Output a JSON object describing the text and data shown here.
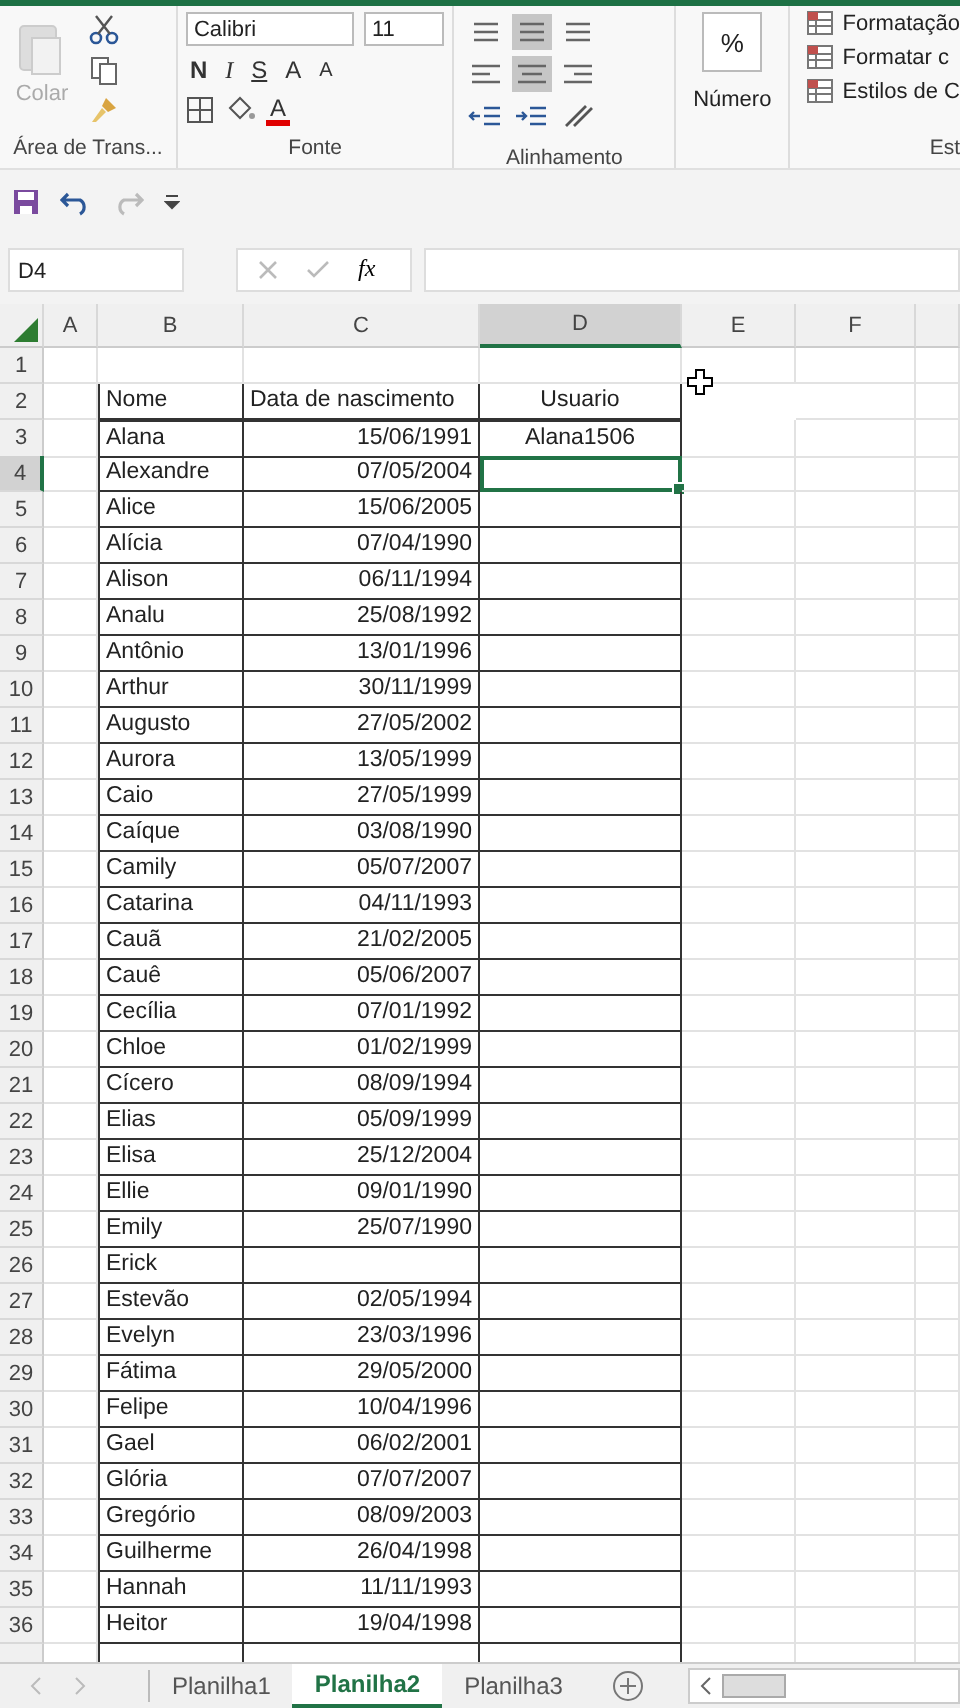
{
  "ribbon": {
    "clipboard": {
      "paste_label": "Colar",
      "group_label": "Área de Trans..."
    },
    "font": {
      "name": "Calibri",
      "size": "11",
      "bold": "N",
      "italic": "I",
      "underline": "S",
      "grow": "A",
      "shrink": "A",
      "font_color": "A",
      "group_label": "Fonte"
    },
    "alignment": {
      "group_label": "Alinhamento"
    },
    "number": {
      "symbol": "%",
      "label": "Número"
    },
    "styles": {
      "items": [
        "Formatação",
        "Formatar c",
        "Estilos de C"
      ],
      "group_label": "Est"
    }
  },
  "name_box": "D4",
  "fx": "fx",
  "columns": [
    {
      "label": "A",
      "selected": false
    },
    {
      "label": "B",
      "selected": false
    },
    {
      "label": "C",
      "selected": false
    },
    {
      "label": "D",
      "selected": true
    },
    {
      "label": "E",
      "selected": false
    },
    {
      "label": "F",
      "selected": false
    }
  ],
  "header": {
    "number": "2",
    "name": "Nome",
    "date": "Data de nascimento",
    "user": "Usuario"
  },
  "rows": [
    {
      "number": "3",
      "name": "Alana",
      "date": "15/06/1991",
      "user": "Alana1506",
      "selected": false
    },
    {
      "number": "4",
      "name": "Alexandre",
      "date": "07/05/2004",
      "selected": true
    },
    {
      "number": "5",
      "name": "Alice",
      "date": "15/06/2005",
      "selected": false
    },
    {
      "number": "6",
      "name": "Alícia",
      "date": "07/04/1990",
      "selected": false
    },
    {
      "number": "7",
      "name": "Alison",
      "date": "06/11/1994",
      "selected": false
    },
    {
      "number": "8",
      "name": "Analu",
      "date": "25/08/1992",
      "selected": false
    },
    {
      "number": "9",
      "name": "Antônio",
      "date": "13/01/1996",
      "selected": false
    },
    {
      "number": "10",
      "name": "Arthur",
      "date": "30/11/1999",
      "selected": false
    },
    {
      "number": "11",
      "name": "Augusto",
      "date": "27/05/2002",
      "selected": false
    },
    {
      "number": "12",
      "name": "Aurora",
      "date": "13/05/1999",
      "selected": false
    },
    {
      "number": "13",
      "name": "Caio",
      "date": "27/05/1999",
      "selected": false
    },
    {
      "number": "14",
      "name": "Caíque",
      "date": "03/08/1990",
      "selected": false
    },
    {
      "number": "15",
      "name": "Camily",
      "date": "05/07/2007",
      "selected": false
    },
    {
      "number": "16",
      "name": "Catarina",
      "date": "04/11/1993",
      "selected": false
    },
    {
      "number": "17",
      "name": "Cauã",
      "date": "21/02/2005",
      "selected": false
    },
    {
      "number": "18",
      "name": "Cauê",
      "date": "05/06/2007",
      "selected": false
    },
    {
      "number": "19",
      "name": "Cecília",
      "date": "07/01/1992",
      "selected": false
    },
    {
      "number": "20",
      "name": "Chloe",
      "date": "01/02/1999",
      "selected": false
    },
    {
      "number": "21",
      "name": "Cícero",
      "date": "08/09/1994",
      "selected": false
    },
    {
      "number": "22",
      "name": "Elias",
      "date": "05/09/1999",
      "selected": false
    },
    {
      "number": "23",
      "name": "Elisa",
      "date": "25/12/2004",
      "selected": false
    },
    {
      "number": "24",
      "name": "Ellie",
      "date": "09/01/1990",
      "selected": false
    },
    {
      "number": "25",
      "name": "Emily",
      "date": "25/07/1990",
      "selected": false
    },
    {
      "number": "26",
      "name": "Erick",
      "selected": false
    },
    {
      "number": "27",
      "name": "Estevão",
      "date": "02/05/1994",
      "selected": false
    },
    {
      "number": "28",
      "name": "Evelyn",
      "date": "23/03/1996",
      "selected": false
    },
    {
      "number": "29",
      "name": "Fátima",
      "date": "29/05/2000",
      "selected": false
    },
    {
      "number": "30",
      "name": "Felipe",
      "date": "10/04/1996",
      "selected": false
    },
    {
      "number": "31",
      "name": "Gael",
      "date": "06/02/2001",
      "selected": false
    },
    {
      "number": "32",
      "name": "Glória",
      "date": "07/07/2007",
      "selected": false
    },
    {
      "number": "33",
      "name": "Gregório",
      "date": "08/09/2003",
      "selected": false
    },
    {
      "number": "34",
      "name": "Guilherme",
      "date": "26/04/1998",
      "selected": false
    },
    {
      "number": "35",
      "name": "Hannah",
      "date": "11/11/1993",
      "selected": false
    },
    {
      "number": "36",
      "name": "Heitor",
      "date": "19/04/1998",
      "selected": false
    }
  ],
  "first_row": "1",
  "sheets": [
    {
      "label": "Planilha1",
      "selected": false
    },
    {
      "label": "Planilha2",
      "selected": true
    },
    {
      "label": "Planilha3",
      "selected": false
    }
  ]
}
